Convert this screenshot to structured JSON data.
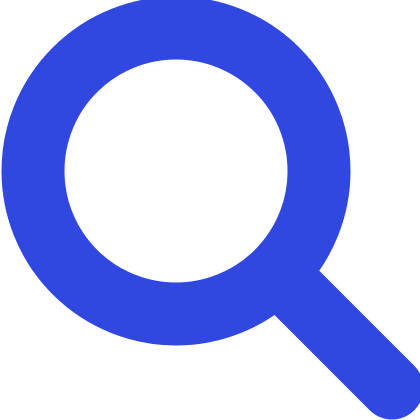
{
  "icon": {
    "name": "search-icon",
    "color": "#3148e0",
    "background": "#ffffff"
  }
}
